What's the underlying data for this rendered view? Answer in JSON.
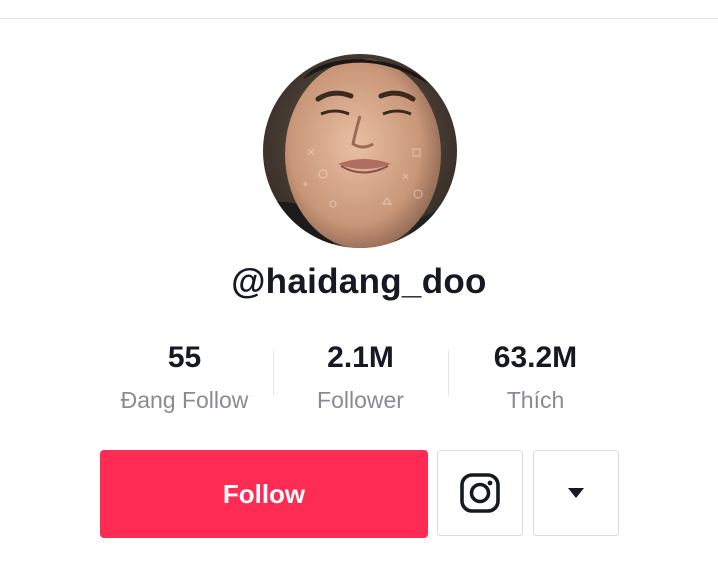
{
  "profile": {
    "username": "@haidang_doo"
  },
  "stats": [
    {
      "value": "55",
      "label": "Đang Follow"
    },
    {
      "value": "2.1M",
      "label": "Follower"
    },
    {
      "value": "63.2M",
      "label": "Thích"
    }
  ],
  "actions": {
    "follow_label": "Follow",
    "instagram_icon": "instagram-icon",
    "more_icon": "caret-down-icon"
  },
  "colors": {
    "follow_bg": "#fe2c55",
    "label_gray": "#8a8b91",
    "text": "#161823"
  }
}
